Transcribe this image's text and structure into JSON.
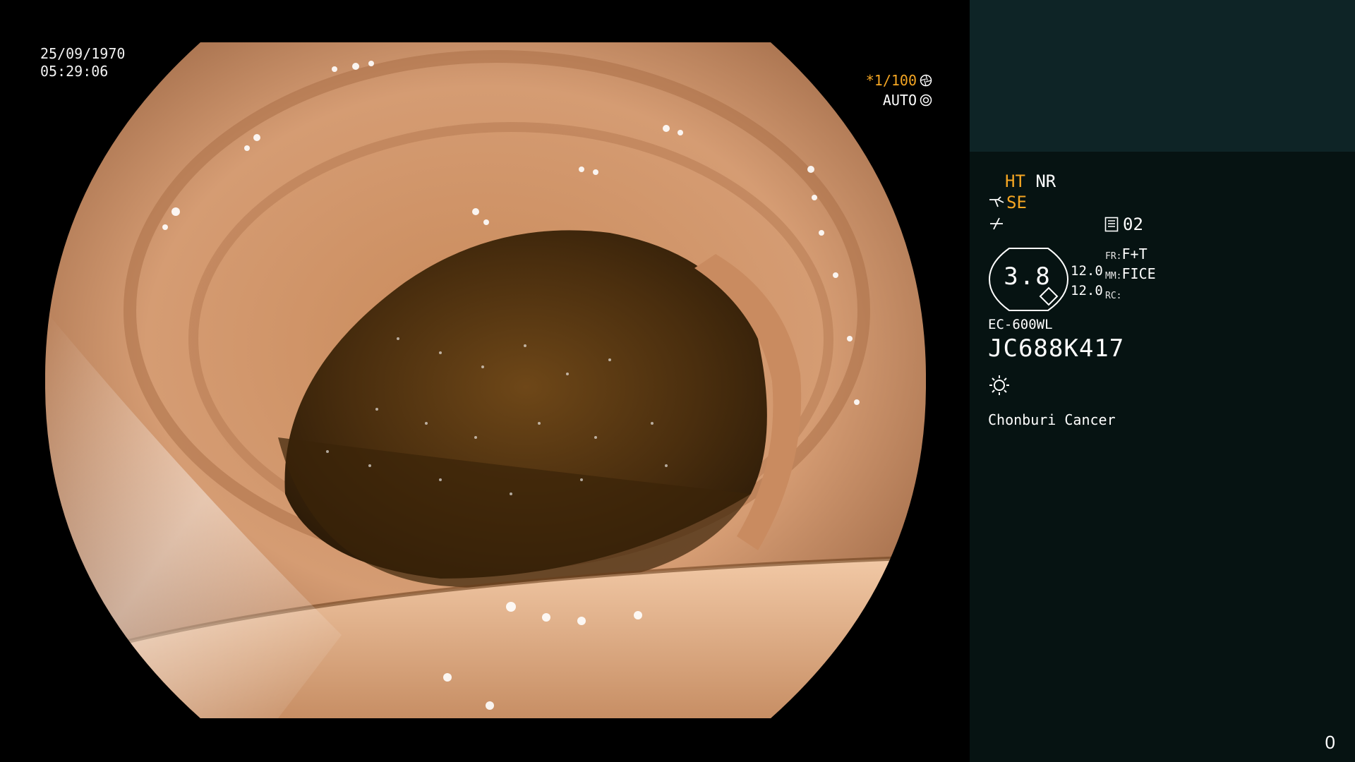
{
  "overlay": {
    "date": "25/09/1970",
    "time": "05:29:06",
    "shutter_speed": "*1/100",
    "iris_mode": "AUTO"
  },
  "panel": {
    "structure_enhance": "HT",
    "noise_reduction": "NR",
    "enhancement_mode": "SE",
    "page_number": "02",
    "zoom_value": "3.8",
    "level_1": "12.0",
    "level_2": "12.0",
    "fr_label": "FR:",
    "fr_value": "F+T",
    "mm_label": "MM:",
    "mm_value": "FICE",
    "rc_label": "RC:",
    "rc_value": "",
    "scope_model": "EC-600WL",
    "scope_serial": "JC688K417",
    "hospital": "Chonburi Cancer",
    "frame_counter": "0"
  },
  "icons": {
    "shutter": "aperture-icon",
    "iris": "iris-icon",
    "se": "scope-tip-icon",
    "signal": "signal-icon",
    "page": "memory-card-icon",
    "light": "light-source-icon"
  },
  "colors": {
    "accent": "#f5a623",
    "panel_top": "#0e2426",
    "panel_bottom": "#061312"
  }
}
